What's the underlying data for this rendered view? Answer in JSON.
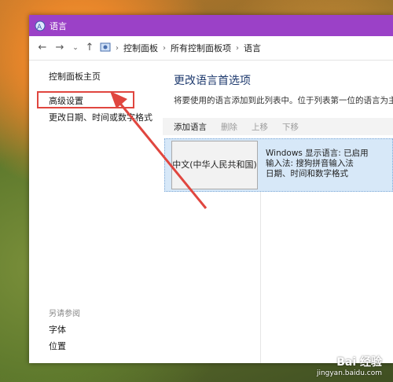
{
  "window": {
    "title": "语言"
  },
  "breadcrumb": [
    "控制面板",
    "所有控制面板项",
    "语言"
  ],
  "sidebar": {
    "items": [
      "控制面板主页",
      "高级设置",
      "更改日期、时间或数字格式"
    ],
    "see_also_label": "另请参阅",
    "see_also_items": [
      "字体",
      "位置"
    ]
  },
  "main": {
    "heading": "更改语言首选项",
    "description": "将要使用的语言添加到此列表中。位于列表第一位的语言为主语",
    "toolbar": {
      "add": "添加语言",
      "remove": "删除",
      "move_up": "上移",
      "move_down": "下移"
    },
    "language": {
      "name": "中文(中华人民共和国)",
      "info": [
        "Windows 显示语言: 已启用",
        "输入法: 搜狗拼音输入法",
        "日期、时间和数字格式"
      ]
    }
  },
  "watermark": {
    "logo": "Bai 经验",
    "url": "jingyan.baidu.com"
  },
  "colors": {
    "titlebar": "#9b41c7",
    "highlight": "#e0463f",
    "selected_row": "#d7e8f8"
  }
}
